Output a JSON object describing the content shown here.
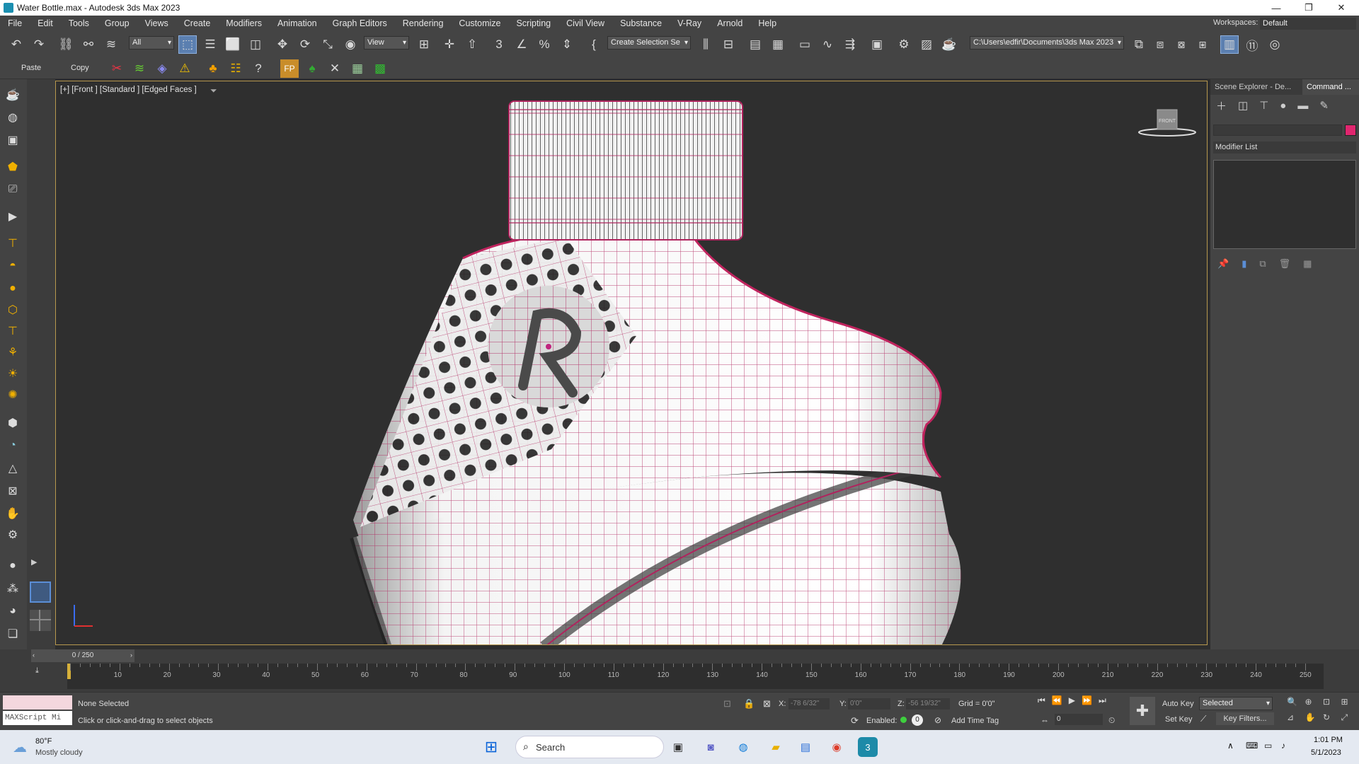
{
  "window": {
    "title": "Water Bottle.max - Autodesk 3ds Max 2023",
    "minimize": "—",
    "maximize": "❐",
    "close": "✕"
  },
  "menu": [
    "File",
    "Edit",
    "Tools",
    "Group",
    "Views",
    "Create",
    "Modifiers",
    "Animation",
    "Graph Editors",
    "Rendering",
    "Customize",
    "Scripting",
    "Civil View",
    "Substance",
    "V-Ray",
    "Arnold",
    "Help"
  ],
  "workspace": {
    "label": "Workspaces:",
    "value": "Default"
  },
  "toolbar": {
    "filter_value": "All",
    "ref_coord_value": "View",
    "named_selection": "Create Selection Se",
    "project_path": "C:\\Users\\edfir\\Documents\\3ds Max 2023",
    "paste_label": "Paste",
    "copy_label": "Copy"
  },
  "viewport": {
    "label": "[+] [Front ] [Standard ] [Edged Faces ]",
    "viewcube_label": "FRONT"
  },
  "command_panel": {
    "tabs": [
      "Scene Explorer - De...",
      "Command ..."
    ],
    "modifier_list": "Modifier List",
    "object_color": "#e0266f"
  },
  "timeline": {
    "frame_counter": "0 / 250",
    "ticks": [
      "10",
      "20",
      "30",
      "40",
      "50",
      "60",
      "70",
      "80",
      "90",
      "100",
      "110",
      "120",
      "130",
      "140",
      "150",
      "160",
      "170",
      "180",
      "190",
      "200",
      "210",
      "220",
      "230",
      "240",
      "250"
    ]
  },
  "status": {
    "maxscript_placeholder": "MAXScript Mi",
    "selection": "None Selected",
    "prompt": "Click or click-and-drag to select objects",
    "x_label": "X:",
    "x_value": "-78 6/32\"",
    "y_label": "Y:",
    "y_value": "0'0\"",
    "z_label": "Z:",
    "z_value": "-56 19/32\"",
    "grid": "Grid = 0'0\"",
    "enabled_label": "Enabled:",
    "add_time_tag": "Add Time Tag",
    "auto_key": "Auto Key",
    "set_key": "Set Key",
    "key_mode": "Selected",
    "key_filters": "Key Filters...",
    "frame_value": "0"
  },
  "taskbar": {
    "weather_temp": "80°F",
    "weather_desc": "Mostly cloudy",
    "search_label": "Search",
    "time": "1:01 PM",
    "date": "5/1/2023"
  }
}
